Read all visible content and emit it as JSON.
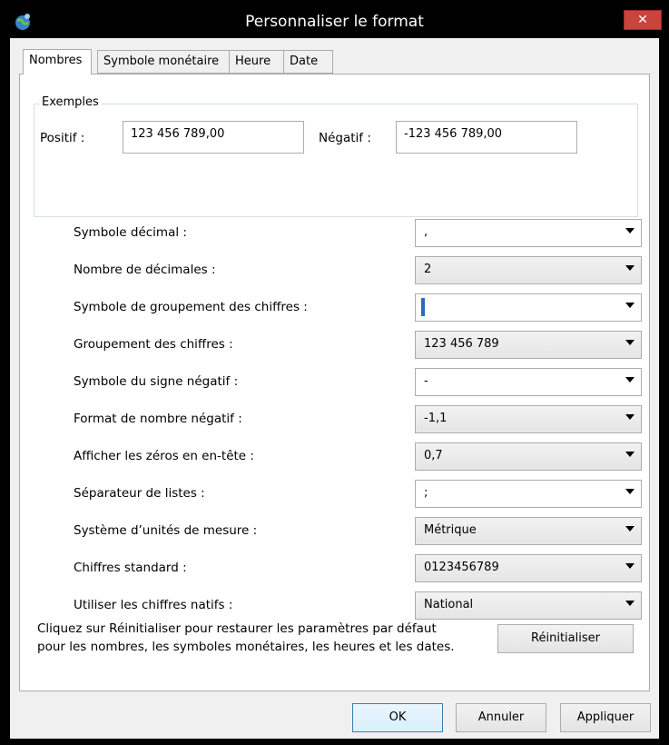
{
  "window": {
    "title": "Personnaliser le format",
    "close_icon": "close-icon"
  },
  "tabs": [
    {
      "label": "Nombres",
      "active": true
    },
    {
      "label": "Symbole monétaire",
      "active": false
    },
    {
      "label": "Heure",
      "active": false
    },
    {
      "label": "Date",
      "active": false
    }
  ],
  "examples": {
    "legend": "Exemples",
    "positive_label": "Positif :",
    "positive_value": "123 456 789,00",
    "negative_label": "Négatif :",
    "negative_value": "-123 456 789,00"
  },
  "settings": [
    {
      "label": "Symbole décimal :",
      "value": ",",
      "editable": true
    },
    {
      "label": "Nombre de décimales :",
      "value": "2",
      "editable": false
    },
    {
      "label": "Symbole de groupement des chiffres :",
      "value": "",
      "editable": true
    },
    {
      "label": "Groupement des chiffres :",
      "value": "123 456 789",
      "editable": false
    },
    {
      "label": "Symbole du signe négatif :",
      "value": "-",
      "editable": true
    },
    {
      "label": "Format de nombre négatif :",
      "value": "-1,1",
      "editable": false
    },
    {
      "label": "Afficher les zéros en en-tête :",
      "value": "0,7",
      "editable": false
    },
    {
      "label": "Séparateur de listes :",
      "value": ";",
      "editable": true
    },
    {
      "label": "Système d’unités de mesure :",
      "value": "Métrique",
      "editable": false
    },
    {
      "label": "Chiffres standard :",
      "value": "0123456789",
      "editable": false
    },
    {
      "label": "Utiliser les chiffres natifs :",
      "value": "National",
      "editable": false
    }
  ],
  "help_text": "Cliquez sur Réinitialiser pour restaurer les paramètres par défaut pour les nombres, les symboles monétaires, les heures et les dates.",
  "buttons": {
    "reset": "Réinitialiser",
    "ok": "OK",
    "cancel": "Annuler",
    "apply": "Appliquer"
  },
  "colors": {
    "close_button": "#c8443c",
    "default_button_border": "#3c7fb1",
    "text_caret": "#2a6ac1"
  }
}
